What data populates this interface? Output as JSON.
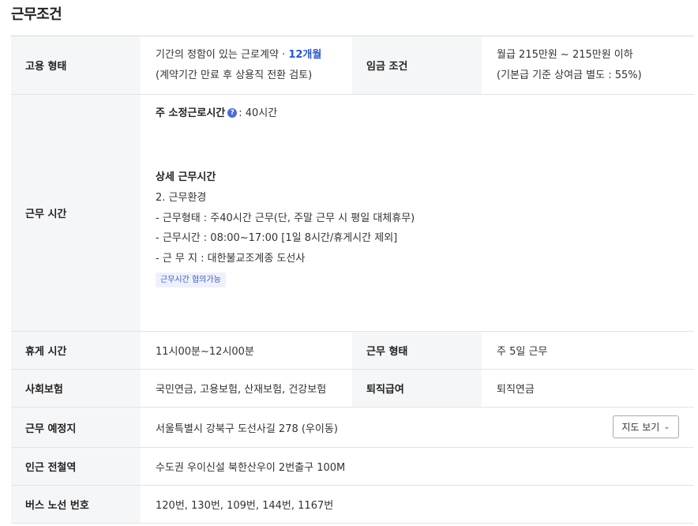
{
  "section_title": "근무조건",
  "employment": {
    "label": "고용 형태",
    "line1_prefix": "기간의 정함이 있는 근로계약 · ",
    "line1_highlight": "12개월",
    "line2": "(계약기간 만료 후 상용직 전환 검토)"
  },
  "wage": {
    "label": "임금 조건",
    "line1": "월급 215만원 ~ 215만원 이하",
    "line2": "(기본급 기준 상여금 별도 : 55%)"
  },
  "work_hours": {
    "label": "근무 시간",
    "weekly_label": "주 소정근로시간",
    "weekly_value": ": 40시간",
    "help_icon": "question-icon",
    "detail_title": "상세 근무시간",
    "lines": [
      "2. 근무환경",
      "- 근무형태 : 주40시간 근무(단, 주말 근무 시 평일 대체휴무)",
      "- 근무시간 : 08:00~17:00 [1일 8시간/휴게시간 제외]",
      "- 근 무 지 : 대한불교조계종 도선사"
    ],
    "tag": "근무시간 협의가능"
  },
  "break_time": {
    "label": "휴게 시간",
    "value": "11시00분~12시00분"
  },
  "work_type": {
    "label": "근무 형태",
    "value": "주 5일 근무"
  },
  "insurance": {
    "label": "사회보험",
    "value": "국민연금, 고용보험, 산재보험, 건강보험"
  },
  "severance": {
    "label": "퇴직급여",
    "value": "퇴직연금"
  },
  "location": {
    "label": "근무 예정지",
    "value": "서울특별시 강북구 도선사길 278 (우이동)",
    "map_button": "지도 보기",
    "chevron_icon": "chevron-down-icon"
  },
  "subway": {
    "label": "인근 전철역",
    "value": "수도권 우이신설 북한산우이 2번출구 100M"
  },
  "bus": {
    "label": "버스 노선 번호",
    "value": "120번, 130번, 109번, 144번, 1167번"
  }
}
